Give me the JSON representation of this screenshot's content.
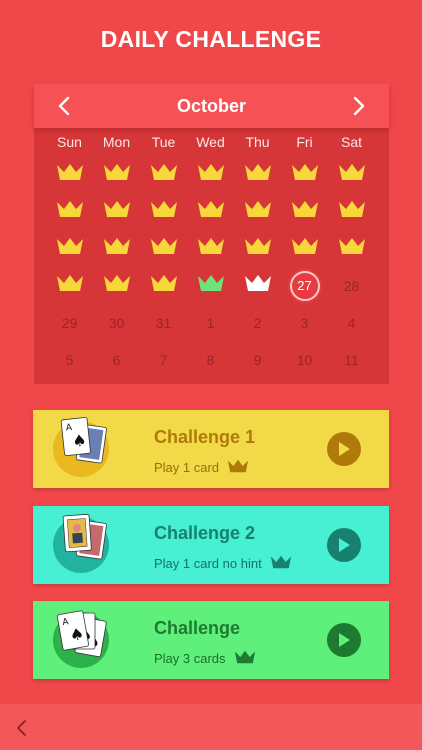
{
  "page": {
    "title": "DAILY CHALLENGE"
  },
  "calendar": {
    "month": "October",
    "weekdays": [
      "Sun",
      "Mon",
      "Tue",
      "Wed",
      "Thu",
      "Fri",
      "Sat"
    ],
    "rows": [
      [
        {
          "t": "crown",
          "c": "gold"
        },
        {
          "t": "crown",
          "c": "gold"
        },
        {
          "t": "crown",
          "c": "gold"
        },
        {
          "t": "crown",
          "c": "gold"
        },
        {
          "t": "crown",
          "c": "gold"
        },
        {
          "t": "crown",
          "c": "gold"
        },
        {
          "t": "crown",
          "c": "gold"
        }
      ],
      [
        {
          "t": "crown",
          "c": "gold"
        },
        {
          "t": "crown",
          "c": "gold"
        },
        {
          "t": "crown",
          "c": "gold"
        },
        {
          "t": "crown",
          "c": "gold"
        },
        {
          "t": "crown",
          "c": "gold"
        },
        {
          "t": "crown",
          "c": "gold"
        },
        {
          "t": "crown",
          "c": "gold"
        }
      ],
      [
        {
          "t": "crown",
          "c": "gold"
        },
        {
          "t": "crown",
          "c": "gold"
        },
        {
          "t": "crown",
          "c": "gold"
        },
        {
          "t": "crown",
          "c": "gold"
        },
        {
          "t": "crown",
          "c": "gold"
        },
        {
          "t": "crown",
          "c": "gold"
        },
        {
          "t": "crown",
          "c": "gold"
        }
      ],
      [
        {
          "t": "crown",
          "c": "gold"
        },
        {
          "t": "crown",
          "c": "gold"
        },
        {
          "t": "crown",
          "c": "gold"
        },
        {
          "t": "crown",
          "c": "green"
        },
        {
          "t": "crown",
          "c": "white"
        },
        {
          "t": "today",
          "n": "27"
        },
        {
          "t": "num",
          "n": "28"
        }
      ],
      [
        {
          "t": "num",
          "n": "29"
        },
        {
          "t": "num",
          "n": "30"
        },
        {
          "t": "num",
          "n": "31"
        },
        {
          "t": "num",
          "n": "1"
        },
        {
          "t": "num",
          "n": "2"
        },
        {
          "t": "num",
          "n": "3"
        },
        {
          "t": "num",
          "n": "4"
        }
      ],
      [
        {
          "t": "num",
          "n": "5"
        },
        {
          "t": "num",
          "n": "6"
        },
        {
          "t": "num",
          "n": "7"
        },
        {
          "t": "num",
          "n": "8"
        },
        {
          "t": "num",
          "n": "9"
        },
        {
          "t": "num",
          "n": "10"
        },
        {
          "t": "num",
          "n": "11"
        }
      ]
    ],
    "crown_colors": {
      "gold": "#f7d73a",
      "green": "#6fe37a",
      "white": "#ffffff"
    }
  },
  "challenges": [
    {
      "title": "Challenge 1",
      "subtitle": "Play 1 card",
      "icon": "ace-of-spades-cards",
      "bg": "#f2d948",
      "badge": "#e9b91f",
      "title_color": "#b07a0a",
      "sub_color": "#9a6c10",
      "play_color": "#b07a0a",
      "crown_color": "#b07a0a"
    },
    {
      "title": "Challenge 2",
      "subtitle": "Play 1 card no hint",
      "icon": "jack-cards",
      "bg": "#47efd3",
      "badge": "#22b3a0",
      "title_color": "#18806f",
      "sub_color": "#167365",
      "play_color": "#18806f",
      "crown_color": "#18806f"
    },
    {
      "title": "Challenge",
      "subtitle": "Play 3 cards",
      "icon": "three-aces-cards",
      "bg": "#5ff07b",
      "badge": "#2db14a",
      "title_color": "#1d7a30",
      "sub_color": "#1c6d2c",
      "play_color": "#1d7a30",
      "crown_color": "#1d7a30"
    }
  ]
}
